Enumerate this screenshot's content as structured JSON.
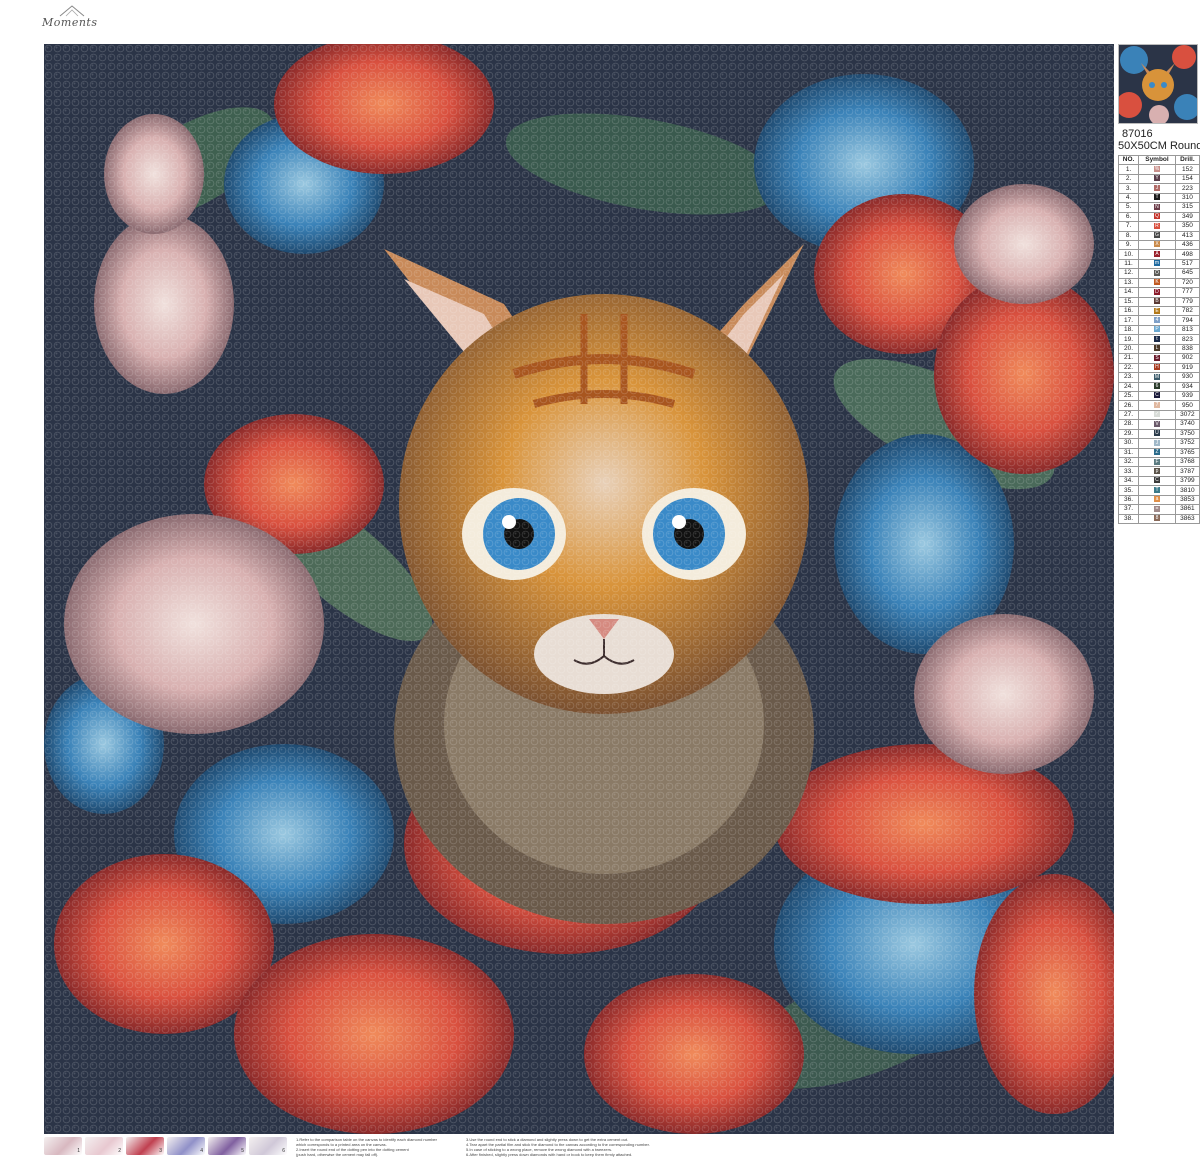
{
  "brand": {
    "logo_text": "Moments"
  },
  "product": {
    "code": "87016",
    "size": "50X50CM Round"
  },
  "legend": {
    "headers": [
      "NO.",
      "Symbol",
      "Drill."
    ],
    "rows": [
      {
        "no": "1.",
        "symbol": "%",
        "drill": "152",
        "color": "#c98f8a"
      },
      {
        "no": "2.",
        "symbol": "Y",
        "drill": "154",
        "color": "#5a3d4a"
      },
      {
        "no": "3.",
        "symbol": "J",
        "drill": "223",
        "color": "#b06a66"
      },
      {
        "no": "4.",
        "symbol": "T",
        "drill": "310",
        "color": "#1a1a1a"
      },
      {
        "no": "5.",
        "symbol": "N",
        "drill": "315",
        "color": "#6a3b48"
      },
      {
        "no": "6.",
        "symbol": "Q",
        "drill": "349",
        "color": "#c4352c"
      },
      {
        "no": "7.",
        "symbol": "R",
        "drill": "350",
        "color": "#d9503f"
      },
      {
        "no": "8.",
        "symbol": "G",
        "drill": "413",
        "color": "#4a4a4a"
      },
      {
        "no": "9.",
        "symbol": "X",
        "drill": "436",
        "color": "#c98a4a"
      },
      {
        "no": "10.",
        "symbol": "A",
        "drill": "498",
        "color": "#9a1f2a"
      },
      {
        "no": "11.",
        "symbol": "m",
        "drill": "517",
        "color": "#1f6aa0"
      },
      {
        "no": "12.",
        "symbol": "O",
        "drill": "645",
        "color": "#5a5a56"
      },
      {
        "no": "13.",
        "symbol": "K",
        "drill": "720",
        "color": "#c0581f"
      },
      {
        "no": "14.",
        "symbol": "D",
        "drill": "777",
        "color": "#8a1a2a"
      },
      {
        "no": "15.",
        "symbol": "B",
        "drill": "779",
        "color": "#5a3a34"
      },
      {
        "no": "16.",
        "symbol": "E",
        "drill": "782",
        "color": "#b37a1a"
      },
      {
        "no": "17.",
        "symbol": "4",
        "drill": "794",
        "color": "#7fa0c8"
      },
      {
        "no": "18.",
        "symbol": "P",
        "drill": "813",
        "color": "#6aa8d0"
      },
      {
        "no": "19.",
        "symbol": "t",
        "drill": "823",
        "color": "#1a2a48"
      },
      {
        "no": "20.",
        "symbol": "L",
        "drill": "838",
        "color": "#4a3a2a"
      },
      {
        "no": "21.",
        "symbol": "S",
        "drill": "902",
        "color": "#6a1a2a"
      },
      {
        "no": "22.",
        "symbol": "H",
        "drill": "919",
        "color": "#a83a1f"
      },
      {
        "no": "23.",
        "symbol": "M",
        "drill": "930",
        "color": "#3a5a6a"
      },
      {
        "no": "24.",
        "symbol": "6",
        "drill": "934",
        "color": "#2a3a2a"
      },
      {
        "no": "25.",
        "symbol": "C",
        "drill": "939",
        "color": "#1a1a3a"
      },
      {
        "no": "26.",
        "symbol": "7",
        "drill": "950",
        "color": "#e0b8a0"
      },
      {
        "no": "27.",
        "symbol": "✓",
        "drill": "3072",
        "color": "#d8dcd8"
      },
      {
        "no": "28.",
        "symbol": "V",
        "drill": "3740",
        "color": "#6a5a6a"
      },
      {
        "no": "29.",
        "symbol": "U",
        "drill": "3750",
        "color": "#2a3a4a"
      },
      {
        "no": "30.",
        "symbol": "J",
        "drill": "3752",
        "color": "#a0b8c8"
      },
      {
        "no": "31.",
        "symbol": "Z",
        "drill": "3765",
        "color": "#2a6a8a"
      },
      {
        "no": "32.",
        "symbol": "F",
        "drill": "3768",
        "color": "#5a7a80"
      },
      {
        "no": "33.",
        "symbol": "p",
        "drill": "3787",
        "color": "#5a5248"
      },
      {
        "no": "34.",
        "symbol": "C",
        "drill": "3799",
        "color": "#3a3a3a"
      },
      {
        "no": "35.",
        "symbol": "T",
        "drill": "3810",
        "color": "#3a7a8a"
      },
      {
        "no": "36.",
        "symbol": "a",
        "drill": "3853",
        "color": "#e0904a"
      },
      {
        "no": "37.",
        "symbol": "=",
        "drill": "3861",
        "color": "#a08a8a"
      },
      {
        "no": "38.",
        "symbol": "8",
        "drill": "3863",
        "color": "#8a6a5a"
      }
    ]
  },
  "instructions": {
    "col1": [
      "1.Refer to the comparison table on the canvas to identify each diamond number",
      "which corresponds to a printed area on the canvas.",
      "2.Insert the round end of the dotting pen into the dotting cement",
      "(push hard, otherwise the cement may fall off)."
    ],
    "col2": [
      "3.Use the round end to stick a diamond and slightly press down to get the extra cement out.",
      "4.Tear apart the partial film and stick the diamond to the canvas according to the corresponding number.",
      "5.In case of sticking to a wrong place, remove the wrong diamond with a tweezers.",
      "6.After finished, slightly press down diamonds with hand or book to keep them firmly attached."
    ]
  },
  "steps": {
    "items": [
      {
        "label": "1",
        "color": "#d8b8c0"
      },
      {
        "label": "2",
        "color": "#e8c8d0"
      },
      {
        "label": "3",
        "color": "#c04050"
      },
      {
        "label": "4",
        "color": "#9090c8"
      },
      {
        "label": "5",
        "color": "#8060a0"
      },
      {
        "label": "6",
        "color": "#d0c8d8"
      }
    ]
  },
  "palette": {
    "background": "#2b3447",
    "red": "#d9503f",
    "blue": "#3a82b8",
    "orange": "#d57a2a",
    "pink": "#d8b0b0",
    "green": "#4a6a5a"
  }
}
